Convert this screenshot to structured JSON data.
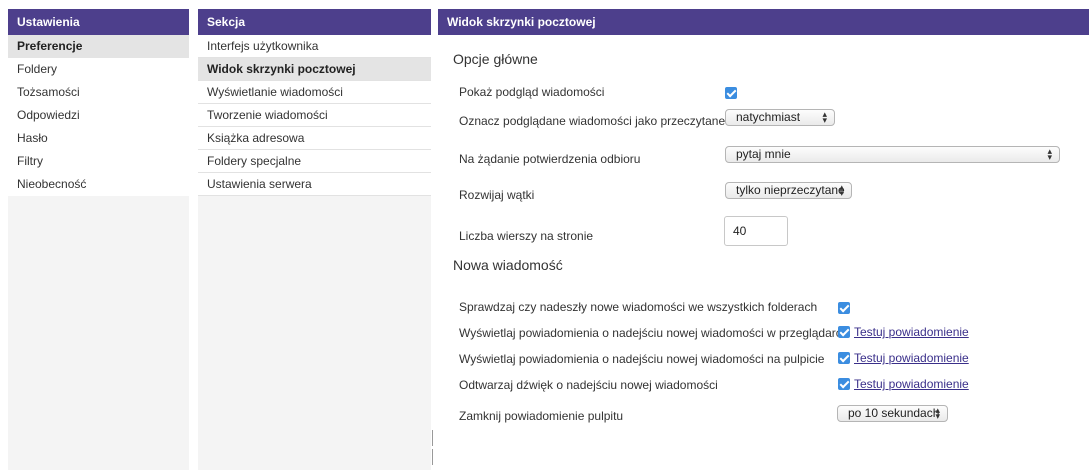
{
  "settings": {
    "header": "Ustawienia",
    "items": [
      "Preferencje",
      "Foldery",
      "Tożsamości",
      "Odpowiedzi",
      "Hasło",
      "Filtry",
      "Nieobecność"
    ]
  },
  "section": {
    "header": "Sekcja",
    "items": [
      "Interfejs użytkownika",
      "Widok skrzynki pocztowej",
      "Wyświetlanie wiadomości",
      "Tworzenie wiadomości",
      "Książka adresowa",
      "Foldery specjalne",
      "Ustawienia serwera"
    ]
  },
  "main": {
    "header": "Widok skrzynki pocztowej",
    "group1": {
      "title": "Opcje główne",
      "preview_label": "Pokaż podgląd wiadomości",
      "mark_read_label": "Oznacz podglądane wiadomości jako przeczytane",
      "mark_read_value": "natychmiast",
      "receipt_label": "Na żądanie potwierdzenia odbioru",
      "receipt_value": "pytaj mnie",
      "threads_label": "Rozwijaj wątki",
      "threads_value": "tylko nieprzeczytane",
      "rows_label": "Liczba wierszy na stronie",
      "rows_value": "40"
    },
    "group2": {
      "title": "Nowa wiadomość",
      "check_all_label": "Sprawdzaj czy nadeszły nowe wiadomości we wszystkich folderach",
      "browser_notify_label": "Wyświetlaj powiadomienia o nadejściu nowej wiadomości w przeglądarce",
      "desktop_notify_label": "Wyświetlaj powiadomienia o nadejściu nowej wiadomości na pulpicie",
      "sound_label": "Odtwarzaj dźwięk o nadejściu nowej wiadomości",
      "test_link": "Testuj powiadomienie",
      "close_label": "Zamknij powiadomienie pulpitu",
      "close_value": "po 10 sekundach"
    }
  }
}
